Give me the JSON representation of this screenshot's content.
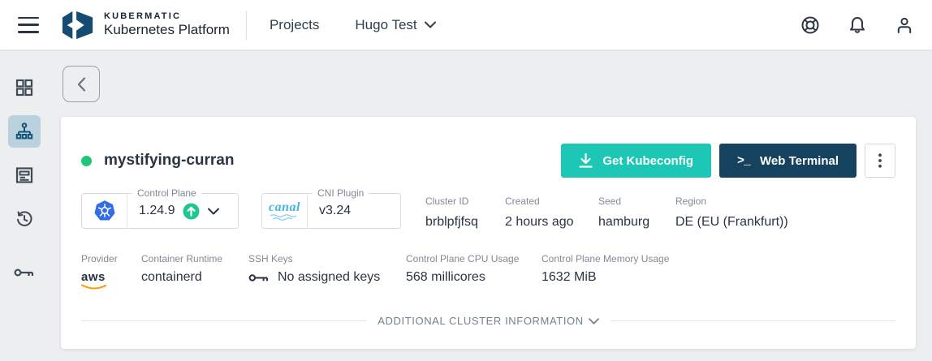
{
  "colors": {
    "accent_teal": "#1dc7b5",
    "navy": "#14425f",
    "status_green": "#1ec776",
    "kubernetes_blue": "#326de6",
    "canal_blue": "#45b5e8",
    "aws_orange": "#ff9900",
    "sidebar_selected_bg": "#b9d2de",
    "sidebar_selected_icon": "#0f5679"
  },
  "header": {
    "brand_top": "KUBERMATIC",
    "brand_bottom": "Kubernetes Platform",
    "nav_projects": "Projects",
    "project_name": "Hugo Test",
    "icons": [
      "help-buoy-icon",
      "notifications-bell-icon",
      "user-icon"
    ]
  },
  "sidebar": {
    "items": [
      {
        "name": "projects",
        "icon": "grid-icon",
        "selected": false
      },
      {
        "name": "clusters",
        "icon": "cluster-tree-icon",
        "selected": true
      },
      {
        "name": "external-clusters",
        "icon": "form-icon",
        "selected": false
      },
      {
        "name": "activity",
        "icon": "history-icon",
        "selected": false
      },
      {
        "name": "ssh-keys",
        "icon": "key-icon",
        "selected": false
      }
    ]
  },
  "cluster": {
    "name": "mystifying-curran",
    "status": "healthy",
    "actions": {
      "kubeconfig_label": "Get Kubeconfig",
      "terminal_label": "Web Terminal",
      "terminal_glyph": ">_"
    },
    "control_plane": {
      "label": "Control Plane",
      "version": "1.24.9"
    },
    "cni": {
      "label": "CNI Plugin",
      "logo_text": "canal",
      "version": "v3.24"
    },
    "stats_row1": [
      {
        "label": "Cluster ID",
        "value": "brblpfjfsq"
      },
      {
        "label": "Created",
        "value": "2 hours ago"
      },
      {
        "label": "Seed",
        "value": "hamburg"
      },
      {
        "label": "Region",
        "value": "DE (EU (Frankfurt))"
      }
    ],
    "stats_row2": [
      {
        "label": "Provider",
        "value": "aws"
      },
      {
        "label": "Container Runtime",
        "value": "containerd"
      },
      {
        "label": "SSH Keys",
        "value": "No assigned keys"
      },
      {
        "label": "Control Plane CPU Usage",
        "value": "568 millicores"
      },
      {
        "label": "Control Plane Memory Usage",
        "value": "1632 MiB"
      }
    ],
    "additional_info_label": "ADDITIONAL CLUSTER INFORMATION"
  }
}
